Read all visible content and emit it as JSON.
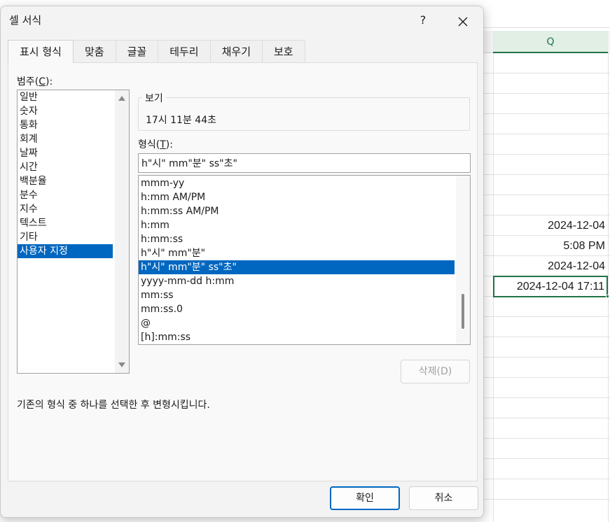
{
  "spreadsheet": {
    "column_header": "Q",
    "cells": [
      "2024-12-04",
      "5:08 PM",
      "2024-12-04",
      "2024-12-04 17:11"
    ]
  },
  "dialog": {
    "title": "셀 서식",
    "help_label": "?",
    "close_label": "✕",
    "tabs": [
      {
        "label": "표시 형식",
        "active": true
      },
      {
        "label": "맞춤"
      },
      {
        "label": "글꼴"
      },
      {
        "label": "테두리"
      },
      {
        "label": "채우기"
      },
      {
        "label": "보호"
      }
    ],
    "category_label_prefix": "범주(",
    "category_label_key": "C",
    "category_label_suffix": "):",
    "categories": [
      "일반",
      "숫자",
      "통화",
      "회계",
      "날짜",
      "시간",
      "백분율",
      "분수",
      "지수",
      "텍스트",
      "기타",
      "사용자 지정"
    ],
    "selected_category": "사용자 지정",
    "sample_title": "보기",
    "sample_value": "17시 11분 44초",
    "format_label_prefix": "형식(",
    "format_label_key": "T",
    "format_label_suffix": "):",
    "format_input_value": "h\"시\" mm\"분\" ss\"초\"",
    "formats": [
      "mmm-yy",
      "h:mm AM/PM",
      "h:mm:ss AM/PM",
      "h:mm",
      "h:mm:ss",
      "h\"시\" mm\"분\"",
      "h\"시\" mm\"분\" ss\"초\"",
      "yyyy-mm-dd h:mm",
      "mm:ss",
      "mm:ss.0",
      "@",
      "[h]:mm:ss"
    ],
    "selected_format": "h\"시\" mm\"분\" ss\"초\"",
    "delete_label": "삭제(D)",
    "description": "기존의 형식 중 하나를 선택한 후 변형시킵니다.",
    "ok_label": "확인",
    "cancel_label": "취소"
  }
}
